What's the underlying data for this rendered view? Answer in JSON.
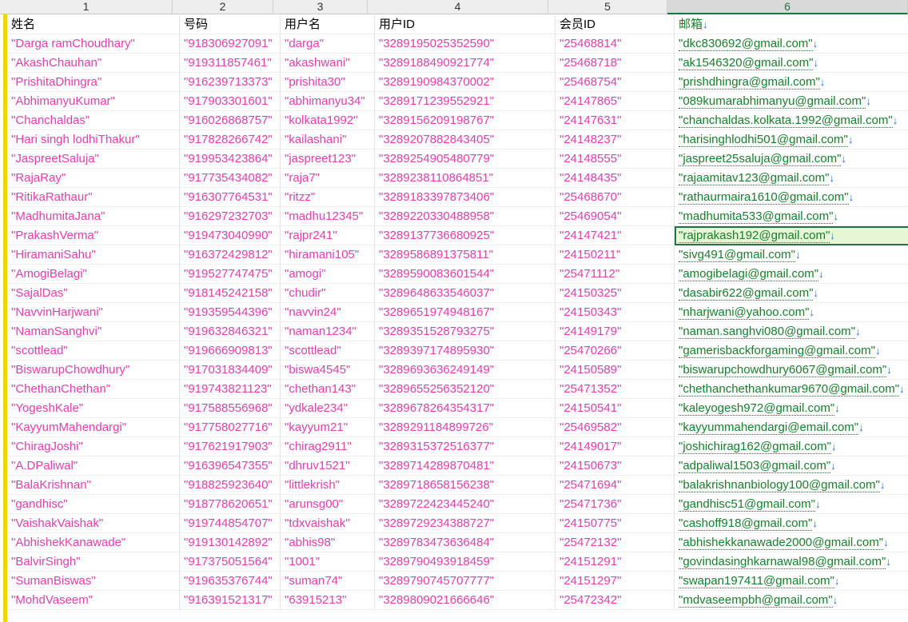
{
  "column_letters": [
    "1",
    "2",
    "3",
    "4",
    "5",
    "6"
  ],
  "selected_column_index": 5,
  "headers": [
    "姓名",
    "号码",
    "用户名",
    "用户ID",
    "会员ID",
    "邮箱"
  ],
  "email_header_arrow": "↓",
  "active_row_index": 10,
  "colors": {
    "text_values": "#e040b0",
    "email_text": "#1a7d2c",
    "arrow": "#1a6fd6",
    "left_stripe": "#f2d400",
    "selection": "#217346",
    "active_cell_fill": "#e6f7d6"
  },
  "rows": [
    [
      "\"Darga ramChoudhary\"",
      "\"918306927091\"",
      "\"darga\"",
      "\"3289195025352590\"",
      "\"25468814\"",
      "\"dkc830692@gmail.com\""
    ],
    [
      "\"AkashChauhan\"",
      "\"919311857461\"",
      "\"akashwani\"",
      "\"3289188490921774\"",
      "\"25468718\"",
      "\"ak1546320@gmail.com\""
    ],
    [
      "\"PrishitaDhingra\"",
      "\"916239713373\"",
      "\"prishita30\"",
      "\"3289190984370002\"",
      "\"25468754\"",
      "\"prishdhingra@gmail.com\""
    ],
    [
      "\"AbhimanyuKumar\"",
      "\"917903301601\"",
      "\"abhimanyu34\"",
      "\"3289171239552921\"",
      "\"24147865\"",
      "\"089kumarabhimanyu@gmail.com\""
    ],
    [
      "\"Chanchaldas\"",
      "\"916026868757\"",
      "\"kolkata1992\"",
      "\"3289156209198767\"",
      "\"24147631\"",
      "\"chanchaldas.kolkata.1992@gmail.com\""
    ],
    [
      "\"Hari singh lodhiThakur\"",
      "\"917828266742\"",
      "\"kailashani\"",
      "\"3289207882843405\"",
      "\"24148237\"",
      "\"harisinghlodhi501@gmail.com\""
    ],
    [
      "\"JaspreetSaluja\"",
      "\"919953423864\"",
      "\"jaspreet123\"",
      "\"3289254905480779\"",
      "\"24148555\"",
      "\"jaspreet25saluja@gmail.com\""
    ],
    [
      "\"RajaRay\"",
      "\"917735434082\"",
      "\"raja7\"",
      "\"3289238110864851\"",
      "\"24148435\"",
      "\"rajaamitav123@gmail.com\""
    ],
    [
      "\"RitikaRathaur\"",
      "\"916307764531\"",
      "\"ritzz\"",
      "\"3289183397873406\"",
      "\"25468670\"",
      "\"rathaurmaira1610@gmail.com\""
    ],
    [
      "\"MadhumitaJana\"",
      "\"916297232703\"",
      "\"madhu12345\"",
      "\"3289220330488958\"",
      "\"25469054\"",
      "\"madhumita533@gmail.com\""
    ],
    [
      "\"PrakashVerma\"",
      "\"919473040990\"",
      "\"rajpr241\"",
      "\"3289137736680925\"",
      "\"24147421\"",
      "\"rajprakash192@gmail.com\""
    ],
    [
      "\"HiramaniSahu\"",
      "\"916372429812\"",
      "\"hiramani105\"",
      "\"3289586891375811\"",
      "\"24150211\"",
      "\"sivg491@gmail.com\""
    ],
    [
      "\"AmogiBelagi\"",
      "\"919527747475\"",
      "\"amogi\"",
      "\"3289590083601544\"",
      "\"25471112\"",
      "\"amogibelagi@gmail.com\""
    ],
    [
      "\"SajalDas\"",
      "\"918145242158\"",
      "\"chudir\"",
      "\"3289648633546037\"",
      "\"24150325\"",
      "\"dasabir622@gmail.com\""
    ],
    [
      "\"NavvinHarjwani\"",
      "\"919359544396\"",
      "\"navvin24\"",
      "\"3289651974948167\"",
      "\"24150343\"",
      "\"nharjwani@yahoo.com\""
    ],
    [
      "\"NamanSanghvi\"",
      "\"919632846321\"",
      "\"naman1234\"",
      "\"3289351528793275\"",
      "\"24149179\"",
      "\"naman.sanghvi080@gmail.com\""
    ],
    [
      "\"scottlead\"",
      "\"919666909813\"",
      "\"scottlead\"",
      "\"3289397174895930\"",
      "\"25470266\"",
      "\"gamerisbackforgaming@gmail.com\""
    ],
    [
      "\"BiswarupChowdhury\"",
      "\"917031834409\"",
      "\"biswa4545\"",
      "\"3289693636249149\"",
      "\"24150589\"",
      "\"biswarupchowdhury6067@gmail.com\""
    ],
    [
      "\"ChethanChethan\"",
      "\"919743821123\"",
      "\"chethan143\"",
      "\"3289655256352120\"",
      "\"25471352\"",
      "\"chethanchethankumar9670@gmail.com\""
    ],
    [
      "\"YogeshKale\"",
      "\"917588556968\"",
      "\"ydkale234\"",
      "\"3289678264354317\"",
      "\"24150541\"",
      "\"kaleyogesh972@gmail.com\""
    ],
    [
      "\"KayyumMahendargi\"",
      "\"917758027716\"",
      "\"kayyum21\"",
      "\"3289291184899726\"",
      "\"25469582\"",
      "\"kayyummahendargi@email.com\""
    ],
    [
      "\"ChiragJoshi\"",
      "\"917621917903\"",
      "\"chirag2911\"",
      "\"3289315372516377\"",
      "\"24149017\"",
      "\"joshichirag162@gmail.com\""
    ],
    [
      "\"A.DPaliwal\"",
      "\"916396547355\"",
      "\"dhruv1521\"",
      "\"3289714289870481\"",
      "\"24150673\"",
      "\"adpaliwal1503@gmail.com\""
    ],
    [
      "\"BalaKrishnan\"",
      "\"918825923640\"",
      "\"littlekrish\"",
      "\"3289718658156238\"",
      "\"25471694\"",
      "\"balakrishnanbiology100@gmail.com\""
    ],
    [
      "\"gandhisc\"",
      "\"918778620651\"",
      "\"arunsg00\"",
      "\"3289722423445240\"",
      "\"25471736\"",
      "\"gandhisc51@gmail.com\""
    ],
    [
      "\"VaishakVaishak\"",
      "\"919744854707\"",
      "\"tdxvaishak\"",
      "\"3289729234388727\"",
      "\"24150775\"",
      "\"cashoff918@gmail.com\""
    ],
    [
      "\"AbhishekKanawade\"",
      "\"919130142892\"",
      "\"abhis98\"",
      "\"3289783473636484\"",
      "\"25472132\"",
      "\"abhishekkanawade2000@gmail.com\""
    ],
    [
      "\"BalvirSingh\"",
      "\"917375051564\"",
      "\"1001\"",
      "\"3289790493918459\"",
      "\"24151291\"",
      "\"govindasinghkarnawal98@gmail.com\""
    ],
    [
      "\"SumanBiswas\"",
      "\"919635376744\"",
      "\"suman74\"",
      "\"3289790745707777\"",
      "\"24151297\"",
      "\"swapan197411@gmail.com\""
    ],
    [
      "\"MohdVaseem\"",
      "\"916391521317\"",
      "\"63915213\"",
      "\"3289809021666646\"",
      "\"25472342\"",
      "\"mdvaseempbh@gmail.com\""
    ]
  ]
}
